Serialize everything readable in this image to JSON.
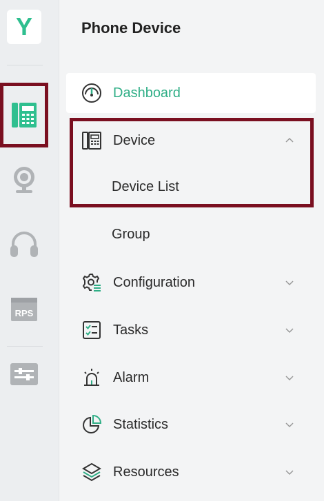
{
  "app": {
    "logo_letter": "Y"
  },
  "rail": {
    "items": [
      {
        "name": "phone-device",
        "icon": "phone-device-icon",
        "active": true
      },
      {
        "name": "webcam",
        "icon": "webcam-icon",
        "active": false
      },
      {
        "name": "headset",
        "icon": "headset-icon",
        "active": false
      },
      {
        "name": "rps",
        "icon": "rps-icon",
        "label": "RPS",
        "active": false
      },
      {
        "name": "settings",
        "icon": "sliders-icon",
        "active": false
      }
    ]
  },
  "panel": {
    "title": "Phone Device",
    "nav": {
      "dashboard": {
        "label": "Dashboard",
        "icon": "gauge-icon"
      },
      "device": {
        "label": "Device",
        "icon": "device-icon",
        "expanded": true
      },
      "device_list": {
        "label": "Device List"
      },
      "group": {
        "label": "Group"
      },
      "configuration": {
        "label": "Configuration",
        "icon": "config-gear-icon"
      },
      "tasks": {
        "label": "Tasks",
        "icon": "tasks-checklist-icon"
      },
      "alarm": {
        "label": "Alarm",
        "icon": "alarm-icon"
      },
      "statistics": {
        "label": "Statistics",
        "icon": "pie-chart-icon"
      },
      "resources": {
        "label": "Resources",
        "icon": "layers-icon"
      }
    }
  },
  "colors": {
    "accent": "#2fae86",
    "highlight_frame": "#7a0f20",
    "rail_bg": "#eceef0",
    "icon_gray": "#b0b3b6"
  }
}
